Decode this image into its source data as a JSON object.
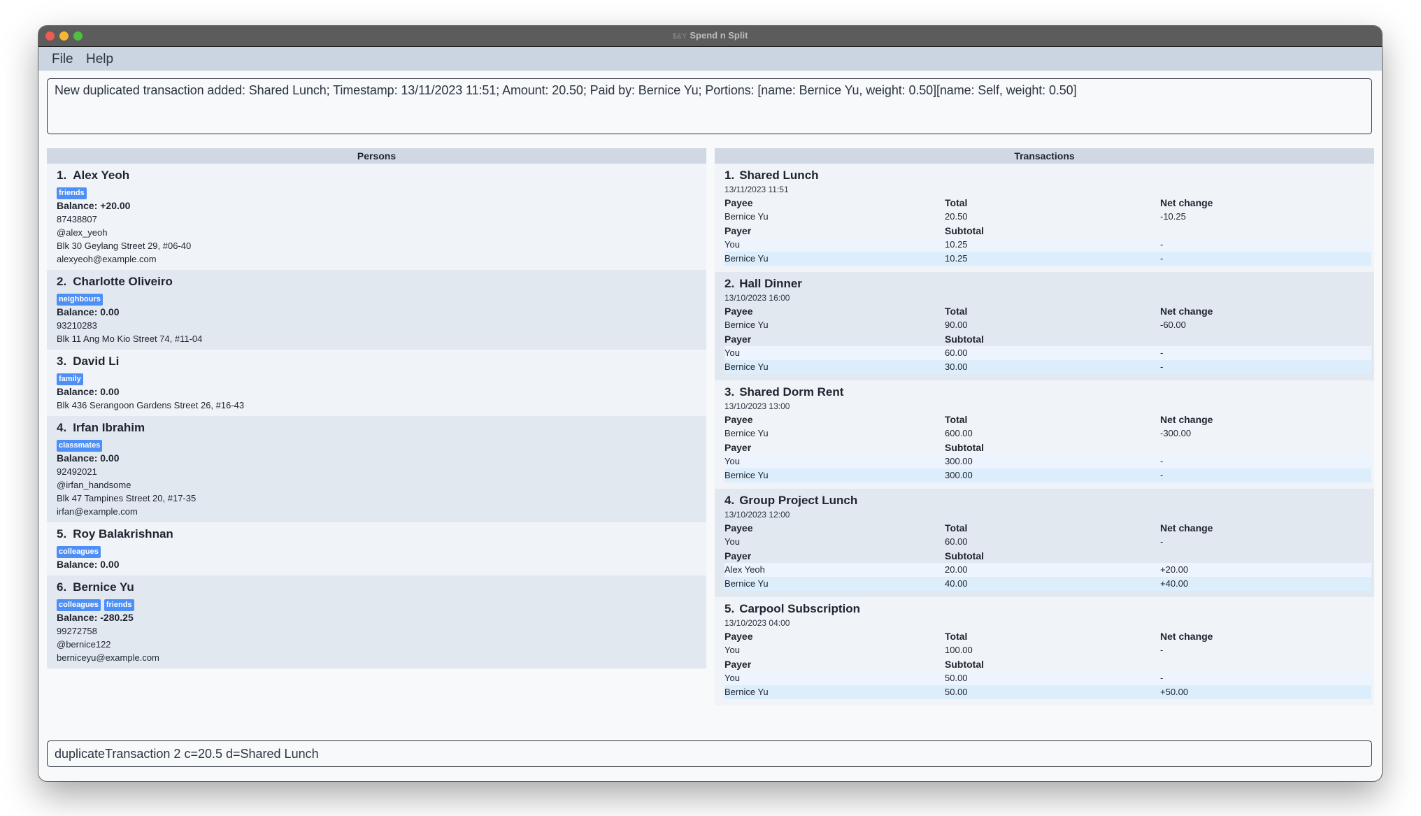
{
  "window": {
    "title": "Spend n Split",
    "app_icon": "$&Y"
  },
  "menu": {
    "items": [
      "File",
      "Help"
    ]
  },
  "result_display": {
    "text": "New duplicated transaction added: Shared Lunch; Timestamp: 13/11/2023 11:51; Amount: 20.50; Paid by: Bernice Yu; Portions: [name: Bernice Yu, weight: 0.50][name: Self, weight: 0.50]"
  },
  "persons_panel": {
    "title": "Persons",
    "persons": [
      {
        "index": "1.",
        "name": "Alex Yeoh",
        "tags": [
          "friends"
        ],
        "balance": "Balance: +20.00",
        "phone": "87438807",
        "telegram": "@alex_yeoh",
        "address": "Blk 30 Geylang Street 29, #06-40",
        "email": "alexyeoh@example.com"
      },
      {
        "index": "2.",
        "name": "Charlotte Oliveiro",
        "tags": [
          "neighbours"
        ],
        "balance": "Balance: 0.00",
        "phone": "93210283",
        "address": "Blk 11 Ang Mo Kio Street 74, #11-04"
      },
      {
        "index": "3.",
        "name": "David Li",
        "tags": [
          "family"
        ],
        "balance": "Balance: 0.00",
        "address": "Blk 436 Serangoon Gardens Street 26, #16-43"
      },
      {
        "index": "4.",
        "name": "Irfan Ibrahim",
        "tags": [
          "classmates"
        ],
        "balance": "Balance: 0.00",
        "phone": "92492021",
        "telegram": "@irfan_handsome",
        "address": "Blk 47 Tampines Street 20, #17-35",
        "email": "irfan@example.com"
      },
      {
        "index": "5.",
        "name": "Roy Balakrishnan",
        "tags": [
          "colleagues"
        ],
        "balance": "Balance: 0.00"
      },
      {
        "index": "6.",
        "name": "Bernice Yu",
        "tags": [
          "colleagues",
          "friends"
        ],
        "balance": "Balance: -280.25",
        "phone": "99272758",
        "telegram": "@bernice122",
        "email": "berniceyu@example.com"
      }
    ]
  },
  "transactions_panel": {
    "title": "Transactions",
    "labels": {
      "payee": "Payee",
      "total": "Total",
      "net_change": "Net change",
      "payer": "Payer",
      "subtotal": "Subtotal"
    },
    "transactions": [
      {
        "index": "1.",
        "name": "Shared Lunch",
        "timestamp": "13/11/2023 11:51",
        "payee": "Bernice Yu",
        "total": "20.50",
        "net_change": "-10.25",
        "payers": [
          {
            "name": "You",
            "subtotal": "10.25",
            "net_change": "-"
          },
          {
            "name": "Bernice Yu",
            "subtotal": "10.25",
            "net_change": "-"
          }
        ]
      },
      {
        "index": "2.",
        "name": "Hall Dinner",
        "timestamp": "13/10/2023 16:00",
        "payee": "Bernice Yu",
        "total": "90.00",
        "net_change": "-60.00",
        "payers": [
          {
            "name": "You",
            "subtotal": "60.00",
            "net_change": "-"
          },
          {
            "name": "Bernice Yu",
            "subtotal": "30.00",
            "net_change": "-"
          }
        ]
      },
      {
        "index": "3.",
        "name": "Shared Dorm Rent",
        "timestamp": "13/10/2023 13:00",
        "payee": "Bernice Yu",
        "total": "600.00",
        "net_change": "-300.00",
        "payers": [
          {
            "name": "You",
            "subtotal": "300.00",
            "net_change": "-"
          },
          {
            "name": "Bernice Yu",
            "subtotal": "300.00",
            "net_change": "-"
          }
        ]
      },
      {
        "index": "4.",
        "name": "Group Project Lunch",
        "timestamp": "13/10/2023 12:00",
        "payee": "You",
        "total": "60.00",
        "net_change": "-",
        "payers": [
          {
            "name": "Alex Yeoh",
            "subtotal": "20.00",
            "net_change": "+20.00"
          },
          {
            "name": "Bernice Yu",
            "subtotal": "40.00",
            "net_change": "+40.00"
          }
        ]
      },
      {
        "index": "5.",
        "name": "Carpool Subscription",
        "timestamp": "13/10/2023 04:00",
        "payee": "You",
        "total": "100.00",
        "net_change": "-",
        "payers": [
          {
            "name": "You",
            "subtotal": "50.00",
            "net_change": "-"
          },
          {
            "name": "Bernice Yu",
            "subtotal": "50.00",
            "net_change": "+50.00"
          }
        ]
      }
    ]
  },
  "command_box": {
    "value": "duplicateTransaction 2 c=20.5 d=Shared Lunch"
  },
  "colors": {
    "tag": "#4e8ff5",
    "menubar": "#cbd5e1",
    "titlebar": "#5c5c5c"
  }
}
